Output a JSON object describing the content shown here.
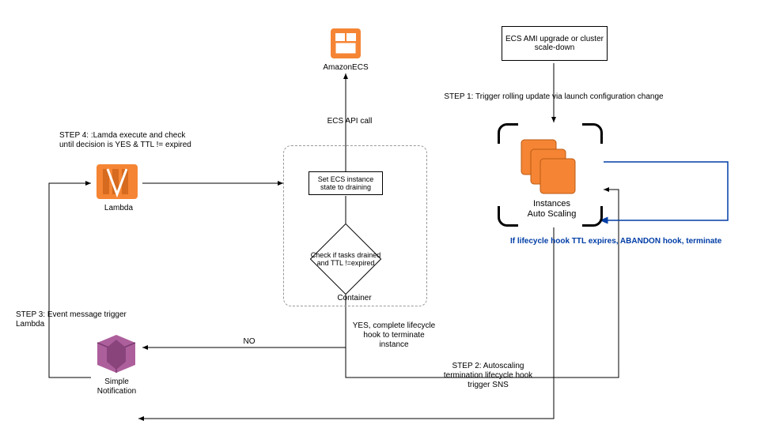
{
  "nodes": {
    "ecs_label": "AmazonECS",
    "upgrade_box": "ECS AMI upgrade or cluster scale-down",
    "set_draining": "Set ECS instance state to draining",
    "check_diamond": "Check if tasks drained and TTL !=expired",
    "container_label": "Container",
    "lambda_label": "Lambda",
    "sns_label": "Simple Notification",
    "asg_label_line1": "Instances",
    "asg_label_line2": "Auto Scaling"
  },
  "edges": {
    "ecs_api": "ECS API call",
    "step1": "STEP 1: Trigger rolling update via launch configuration change",
    "step2": "STEP 2: Autoscaling termination lifecycle hook trigger SNS",
    "step3": "STEP 3: Event message trigger Lambda",
    "step4": "STEP 4: :Lamda execute and check until decision is YES & TTL != expired",
    "no": "NO",
    "yes": "YES, complete lifecycle hook to terminate instance",
    "ttl_expire": "If lifecycle hook TTL expires, ABANDON hook, terminate"
  },
  "chart_data": {
    "type": "diagram",
    "title": "ECS Auto Scaling Lifecycle Hook Flow",
    "nodes": [
      {
        "id": "upgrade",
        "label": "ECS AMI upgrade or cluster scale-down",
        "kind": "box"
      },
      {
        "id": "asg",
        "label": "Instances Auto Scaling",
        "kind": "aws-asg-icon"
      },
      {
        "id": "sns",
        "label": "Simple Notification",
        "kind": "aws-sns-icon"
      },
      {
        "id": "lambda",
        "label": "Lambda",
        "kind": "aws-lambda-icon"
      },
      {
        "id": "container",
        "label": "Container",
        "kind": "dashed-container"
      },
      {
        "id": "set_draining",
        "label": "Set ECS instance state to draining",
        "kind": "box"
      },
      {
        "id": "check",
        "label": "Check if tasks drained and TTL !=expired",
        "kind": "decision"
      },
      {
        "id": "ecs",
        "label": "AmazonECS",
        "kind": "aws-ecs-icon"
      }
    ],
    "edges": [
      {
        "from": "upgrade",
        "to": "asg",
        "label": "STEP 1: Trigger rolling update via launch configuration change"
      },
      {
        "from": "asg",
        "to": "sns",
        "label": "STEP 2: Autoscaling termination lifecycle hook trigger SNS"
      },
      {
        "from": "sns",
        "to": "lambda",
        "label": "STEP 3: Event message trigger Lambda"
      },
      {
        "from": "lambda",
        "to": "container",
        "label": "STEP 4: :Lamda execute and check until decision is YES & TTL != expired"
      },
      {
        "from": "set_draining",
        "to": "ecs",
        "label": "ECS API call"
      },
      {
        "from": "set_draining",
        "to": "check",
        "label": ""
      },
      {
        "from": "check",
        "to": "sns",
        "label": "NO"
      },
      {
        "from": "check",
        "to": "asg",
        "label": "YES, complete lifecycle hook to terminate instance"
      },
      {
        "from": "asg",
        "to": "asg",
        "label": "If lifecycle hook TTL expires, ABANDON hook, terminate",
        "style": "self-loop-blue"
      }
    ]
  }
}
